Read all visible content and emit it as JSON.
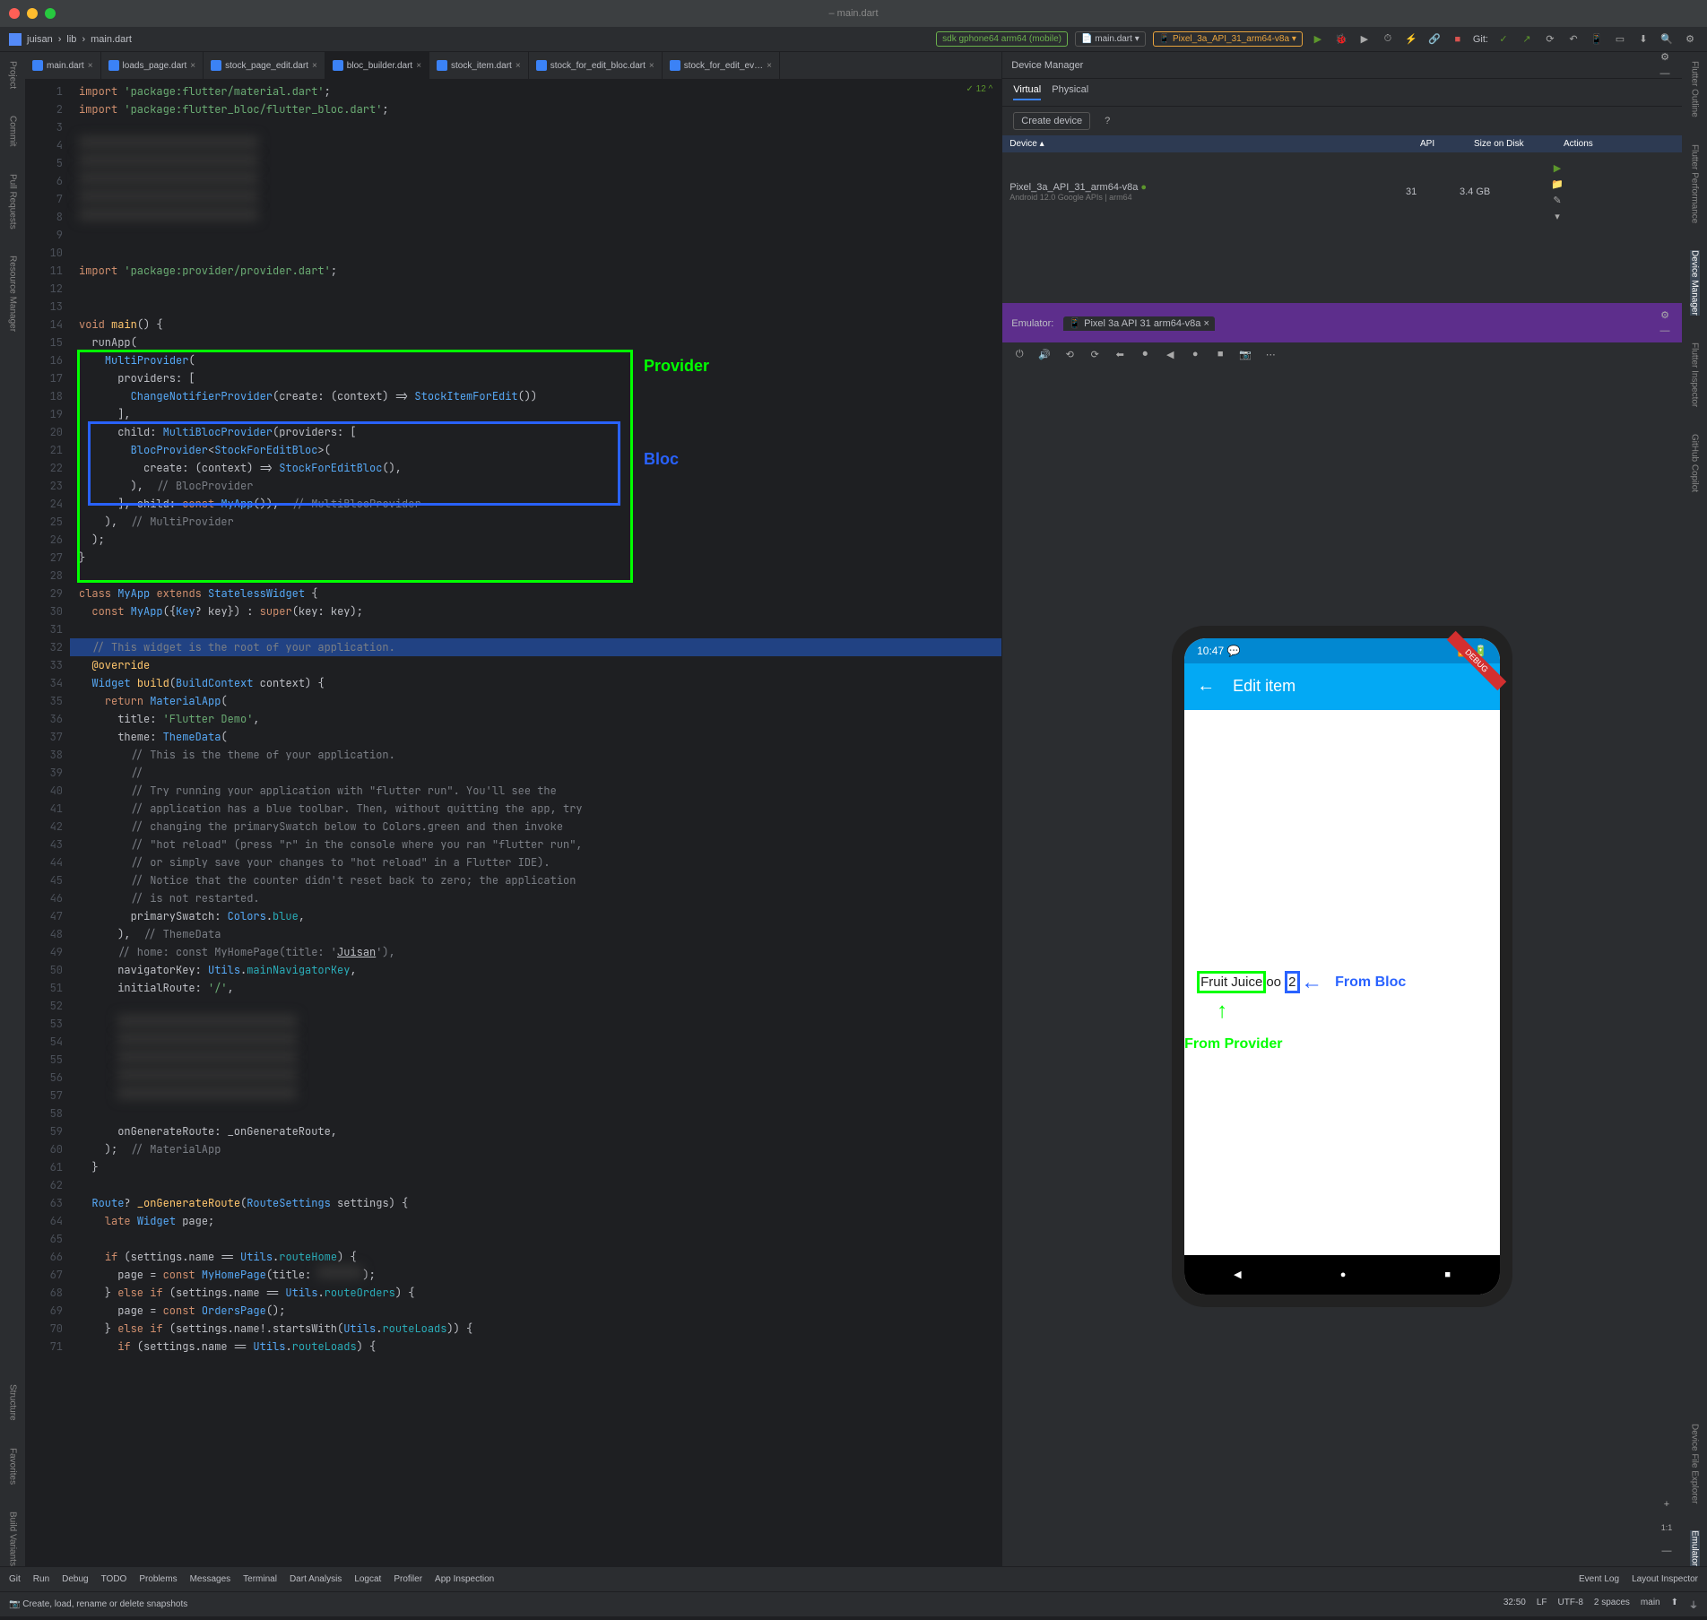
{
  "titlebar": {
    "title": "– main.dart"
  },
  "navbar": {
    "project": "juisan",
    "folder": "lib",
    "file": "main.dart",
    "device_chip": "sdk gphone64 arm64 (mobile)",
    "run_config": "main.dart",
    "emulator_chip": "Pixel_3a_API_31_arm64-v8a",
    "git_label": "Git:"
  },
  "leftrail": [
    "Project",
    "Commit",
    "Pull Requests",
    "Resource Manager",
    "Structure",
    "Favorites",
    "Build Variants"
  ],
  "rightrail": [
    "Flutter Outline",
    "Flutter Performance",
    "Device Manager",
    "Flutter Inspector",
    "GitHub Copilot",
    "Device File Explorer",
    "Emulator"
  ],
  "tabs": [
    {
      "label": "main.dart",
      "close": "×"
    },
    {
      "label": "loads_page.dart",
      "close": "×"
    },
    {
      "label": "stock_page_edit.dart",
      "close": "×"
    },
    {
      "label": "bloc_builder.dart",
      "close": "×",
      "active": true
    },
    {
      "label": "stock_item.dart",
      "close": "×"
    },
    {
      "label": "stock_for_edit_bloc.dart",
      "close": "×"
    },
    {
      "label": "stock_for_edit_ev…",
      "close": "×"
    }
  ],
  "topright_badge": "✓ 12 ^",
  "code_lines": [
    {
      "n": 1,
      "html": "<span class='k'>import</span> <span class='s'>'package:flutter/material.dart'</span>;"
    },
    {
      "n": 2,
      "html": "<span class='k'>import</span> <span class='s'>'package:flutter_bloc/flutter_bloc.dart'</span>;"
    },
    {
      "n": 3,
      "html": ""
    },
    {
      "n": 4,
      "html": "<span class='blurred'>&nbsp;</span>"
    },
    {
      "n": 5,
      "html": "<span class='blurred'>&nbsp;</span>"
    },
    {
      "n": 6,
      "html": "<span class='blurred'>&nbsp;</span>"
    },
    {
      "n": 7,
      "html": "<span class='blurred'>&nbsp;</span>"
    },
    {
      "n": 8,
      "html": "<span class='blurred'>&nbsp;</span>"
    },
    {
      "n": 9,
      "html": ""
    },
    {
      "n": 10,
      "html": ""
    },
    {
      "n": 11,
      "html": "<span class='k'>import</span> <span class='s'>'package:provider/provider.dart'</span>;"
    },
    {
      "n": 12,
      "html": ""
    },
    {
      "n": 13,
      "html": ""
    },
    {
      "n": 14,
      "html": "<span class='k'>void</span> <span class='f'>main</span>() {"
    },
    {
      "n": 15,
      "html": "  runApp("
    },
    {
      "n": 16,
      "html": "    <span class='t'>MultiProvider</span>("
    },
    {
      "n": 17,
      "html": "      providers: ["
    },
    {
      "n": 18,
      "html": "        <span class='t'>ChangeNotifierProvider</span>(create: (context) =&gt; <span class='t'>StockItemForEdit</span>())"
    },
    {
      "n": 19,
      "html": "      ],"
    },
    {
      "n": 20,
      "html": "      child: <span class='t'>MultiBlocProvider</span>(providers: ["
    },
    {
      "n": 21,
      "html": "        <span class='t'>BlocProvider</span>&lt;<span class='t'>StockForEditBloc</span>&gt;("
    },
    {
      "n": 22,
      "html": "          create: (context) =&gt; <span class='t'>StockForEditBloc</span>(),"
    },
    {
      "n": 23,
      "html": "        ),  <span class='c'>// BlocProvider</span>"
    },
    {
      "n": 24,
      "html": "      ], child: <span class='k'>const</span> <span class='t'>MyApp</span>()),  <span class='c'>// MultiBlocProvider</span>"
    },
    {
      "n": 25,
      "html": "    ),  <span class='c'>// MultiProvider</span>"
    },
    {
      "n": 26,
      "html": "  );"
    },
    {
      "n": 27,
      "html": "}"
    },
    {
      "n": 28,
      "html": ""
    },
    {
      "n": 29,
      "html": "<span class='k'>class</span> <span class='t'>MyApp</span> <span class='k'>extends</span> <span class='t'>StatelessWidget</span> {"
    },
    {
      "n": 30,
      "html": "  <span class='k'>const</span> <span class='t'>MyApp</span>({<span class='t'>Key</span>? key}) : <span class='k'>super</span>(key: key);"
    },
    {
      "n": 31,
      "html": ""
    },
    {
      "n": 32,
      "html": "  <span class='c'>// This widget is the root of your application.</span>",
      "sel": true
    },
    {
      "n": 33,
      "html": "  <span class='f'>@override</span>"
    },
    {
      "n": 34,
      "html": "  <span class='t'>Widget</span> <span class='f'>build</span>(<span class='t'>BuildContext</span> context) {"
    },
    {
      "n": 35,
      "html": "    <span class='k'>return</span> <span class='t'>MaterialApp</span>("
    },
    {
      "n": 36,
      "html": "      title: <span class='s'>'Flutter Demo'</span>,"
    },
    {
      "n": 37,
      "html": "      theme: <span class='t'>ThemeData</span>("
    },
    {
      "n": 38,
      "html": "        <span class='c'>// This is the theme of your application.</span>"
    },
    {
      "n": 39,
      "html": "        <span class='c'>//</span>"
    },
    {
      "n": 40,
      "html": "        <span class='c'>// Try running your application with \"flutter run\". You'll see the</span>"
    },
    {
      "n": 41,
      "html": "        <span class='c'>// application has a blue toolbar. Then, without quitting the app, try</span>"
    },
    {
      "n": 42,
      "html": "        <span class='c'>// changing the primarySwatch below to Colors.green and then invoke</span>"
    },
    {
      "n": 43,
      "html": "        <span class='c'>// \"hot reload\" (press \"r\" in the console where you ran \"flutter run\",</span>"
    },
    {
      "n": 44,
      "html": "        <span class='c'>// or simply save your changes to \"hot reload\" in a Flutter IDE).</span>"
    },
    {
      "n": 45,
      "html": "        <span class='c'>// Notice that the counter didn't reset back to zero; the application</span>"
    },
    {
      "n": 46,
      "html": "        <span class='c'>// is not restarted.</span>"
    },
    {
      "n": 47,
      "html": "        primarySwatch: <span class='t'>Colors</span>.<span class='n'>blue</span>,"
    },
    {
      "n": 48,
      "html": "      ),  <span class='c'>// ThemeData</span>"
    },
    {
      "n": 49,
      "html": "      <span class='c'>// home: const MyHomePage(title: '</span><span style='text-decoration:underline'>Juisan</span><span class='c'>'),</span>"
    },
    {
      "n": 50,
      "html": "      navigatorKey: <span class='t'>Utils</span>.<span class='n'>mainNavigatorKey</span>,"
    },
    {
      "n": 51,
      "html": "      initialRoute: <span class='s'>'/'</span>,"
    },
    {
      "n": 52,
      "html": ""
    },
    {
      "n": 53,
      "html": "      <span class='blurred'>&nbsp;</span>"
    },
    {
      "n": 54,
      "html": "      <span class='blurred'>&nbsp;</span>"
    },
    {
      "n": 55,
      "html": "      <span class='blurred'>&nbsp;</span>"
    },
    {
      "n": 56,
      "html": "      <span class='blurred'>&nbsp;</span>"
    },
    {
      "n": 57,
      "html": "      <span class='blurred'>&nbsp;</span>"
    },
    {
      "n": 58,
      "html": ""
    },
    {
      "n": 59,
      "html": "      onGenerateRoute: _onGenerateRoute,"
    },
    {
      "n": 60,
      "html": "    );  <span class='c'>// MaterialApp</span>"
    },
    {
      "n": 61,
      "html": "  }"
    },
    {
      "n": 62,
      "html": ""
    },
    {
      "n": 63,
      "html": "  <span class='t'>Route</span>? <span class='f'>_onGenerateRoute</span>(<span class='t'>RouteSettings</span> settings) {"
    },
    {
      "n": 64,
      "html": "    <span class='k'>late</span> <span class='t'>Widget</span> page;"
    },
    {
      "n": 65,
      "html": ""
    },
    {
      "n": 66,
      "html": "    <span class='k'>if</span> (settings.name == <span class='t'>Utils</span>.<span class='n'>routeHome</span>) {"
    },
    {
      "n": 67,
      "html": "      page = <span class='k'>const</span> <span class='t'>MyHomePage</span>(title: <span class='blurred' style='width:50px'>&nbsp;</span>);"
    },
    {
      "n": 68,
      "html": "    } <span class='k'>else if</span> (settings.name == <span class='t'>Utils</span>.<span class='n'>routeOrders</span>) {"
    },
    {
      "n": 69,
      "html": "      page = <span class='k'>const</span> <span class='t'>OrdersPage</span>();"
    },
    {
      "n": 70,
      "html": "    } <span class='k'>else if</span> (settings.name!.startsWith(<span class='t'>Utils</span>.<span class='n'>routeLoads</span>)) {"
    },
    {
      "n": 71,
      "html": "      <span class='k'>if</span> (settings.name == <span class='t'>Utils</span>.<span class='n'>routeLoads</span>) {"
    }
  ],
  "annotations": {
    "provider_label": "Provider",
    "bloc_label": "Bloc",
    "from_bloc": "From Bloc",
    "from_provider": "From Provider"
  },
  "device_manager": {
    "title": "Device Manager",
    "tabs": [
      "Virtual",
      "Physical"
    ],
    "create": "Create device",
    "help": "?",
    "headers": {
      "device": "Device ▴",
      "api": "API",
      "size": "Size on Disk",
      "actions": "Actions"
    },
    "device": {
      "name": "Pixel_3a_API_31_arm64-v8a",
      "meta": "Android 12.0 Google APIs | arm64",
      "api": "31",
      "size": "3.4 GB"
    }
  },
  "emulator": {
    "label": "Emulator:",
    "tab": "Pixel 3a API 31 arm64-v8a",
    "tab_close": "×",
    "toolbar_icons": [
      "⏻",
      "🔊",
      "⟲",
      "⟳",
      "⬅",
      "⏺",
      "◀",
      "●",
      "■",
      "📷",
      "⋯"
    ]
  },
  "phone": {
    "debug": "DEBUG",
    "time": "10:47",
    "appbar_back": "←",
    "appbar_title": "Edit item",
    "content_p1": "Fruit Juice",
    "content_p2": "oo",
    "content_p3": "2",
    "nav": [
      "◀",
      "●",
      "■"
    ]
  },
  "bottom": {
    "left": [
      "Git",
      "Run",
      "Debug",
      "TODO",
      "Problems",
      "Messages",
      "Terminal",
      "Dart Analysis",
      "Logcat",
      "Profiler",
      "App Inspection"
    ],
    "right": [
      "Event Log",
      "Layout Inspector"
    ]
  },
  "status": {
    "left": "Create, load, rename or delete snapshots",
    "right": [
      "32:50",
      "LF",
      "UTF-8",
      "2 spaces",
      "main",
      "⬆",
      "⏚"
    ]
  }
}
